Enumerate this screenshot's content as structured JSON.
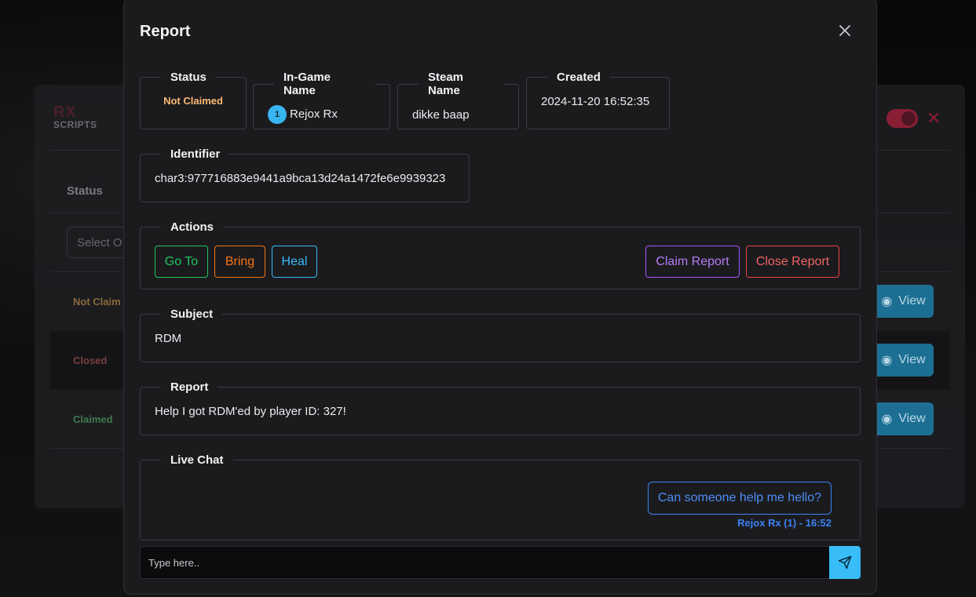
{
  "background": {
    "logo_text": "SCRIPTS",
    "status_header": "Status",
    "select_placeholder": "Select O",
    "rows": [
      {
        "status": "Not Claim",
        "color": "#8b6a3a",
        "view_label": "View"
      },
      {
        "status": "Closed",
        "color": "#7a3f42",
        "view_label": "View"
      },
      {
        "status": "Claimed",
        "color": "#3e7a4e",
        "view_label": "View"
      }
    ]
  },
  "modal": {
    "title": "Report",
    "close_icon": "close-icon",
    "fields": {
      "status": {
        "label": "Status",
        "value": "Not Claimed",
        "color": "#fdba74"
      },
      "ingame_name": {
        "label": "In-Game Name",
        "player_id": "1",
        "value": "Rejox Rx"
      },
      "steam_name": {
        "label": "Steam Name",
        "value": "dikke baap"
      },
      "created": {
        "label": "Created",
        "value": "2024-11-20 16:52:35"
      },
      "identifier": {
        "label": "Identifier",
        "value": "char3:977716883e9441a9bca13d24a1472fe6e9939323"
      }
    },
    "actions": {
      "label": "Actions",
      "goto": {
        "label": "Go To",
        "color": "#22c55e"
      },
      "bring": {
        "label": "Bring",
        "color": "#f97316"
      },
      "heal": {
        "label": "Heal",
        "color": "#38bdf8"
      },
      "claim": {
        "label": "Claim Report",
        "color": "#a855f7"
      },
      "close": {
        "label": "Close Report",
        "color": "#ef4444"
      }
    },
    "subject": {
      "label": "Subject",
      "value": "RDM"
    },
    "report": {
      "label": "Report",
      "value": "Help I got RDM'ed by player ID: 327!"
    },
    "live_chat": {
      "label": "Live Chat",
      "messages": [
        {
          "text": "Can someone help me hello?",
          "meta": "Rejox Rx (1) - 16:52"
        }
      ],
      "input_placeholder": "Type here..",
      "send_icon": "send-icon"
    }
  }
}
